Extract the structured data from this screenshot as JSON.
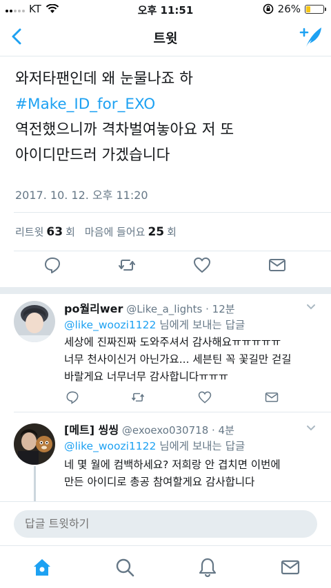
{
  "status_bar": {
    "carrier": "KT",
    "time": "오후 11:51",
    "battery": "26%",
    "battery_level": 0.26
  },
  "nav": {
    "title": "트윗"
  },
  "tweet": {
    "line1": "와저타팬인데 왜 눈물나죠 하",
    "hashtag": "#Make_ID_for_EXO",
    "line3": "역전했으니까 격차벌여놓아요 저 또",
    "line4": "아이디만드러 가겠습니다",
    "date": "2017. 10. 12. 오후 11:20",
    "retweet_label": "리트윗",
    "retweet_count": "63",
    "retweet_unit": "회",
    "like_label": "마음에 들어요",
    "like_count": "25",
    "like_unit": "회"
  },
  "replies": [
    {
      "name": "po월리wer",
      "handle_time": "@Like_a_lights · 12분",
      "mention": "@like_woozi1122",
      "to_suffix": " 님에게 보내는 답글",
      "lines": [
        "세상에 진짜진짜 도와주셔서 감사해요ㅠㅠㅠㅠㅠ",
        "너무 천사이신거 아닌가요... 세븐틴 꼭 꽃길만 걷길",
        "바랄게요 너무너무 감사합니다ㅠㅠㅠ"
      ]
    },
    {
      "name": "[메트] 씽씽",
      "handle_time": "@exoexo030718 · 4분",
      "mention": "@like_woozi1122",
      "to_suffix": " 님에게 보내는 답글",
      "lines": [
        "네 몇 월에 컴백하세요? 저희랑 안 겹치면 이번에",
        "만든 아이디로 총공 참여할게요 감사합니다"
      ]
    }
  ],
  "reply_bar": {
    "placeholder": "답글 트윗하기"
  },
  "colors": {
    "accent": "#1da1f2",
    "secondary_text": "#657786",
    "divider": "#e1e8ed"
  },
  "icons": [
    "back-arrow-icon",
    "compose-feather-icon",
    "reply-icon",
    "retweet-icon",
    "heart-icon",
    "dm-envelope-icon",
    "home-icon",
    "search-icon",
    "bell-icon",
    "mail-icon"
  ]
}
